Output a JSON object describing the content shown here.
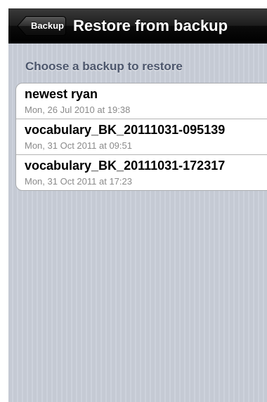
{
  "navbar": {
    "back_label": "Backup",
    "title": "Restore from backup"
  },
  "section": {
    "header": "Choose a backup to restore"
  },
  "backups": [
    {
      "name": "newest ryan",
      "date": "Mon, 26 Jul 2010 at 19:38"
    },
    {
      "name": "vocabulary_BK_20111031-095139",
      "date": "Mon, 31 Oct 2011 at 09:51"
    },
    {
      "name": "vocabulary_BK_20111031-172317",
      "date": "Mon, 31 Oct 2011 at 17:23"
    }
  ],
  "colors": {
    "navbar": "#000000",
    "background": "#c7ccd6",
    "section_header": "#4c566c",
    "subtitle": "#8a8a8a"
  }
}
